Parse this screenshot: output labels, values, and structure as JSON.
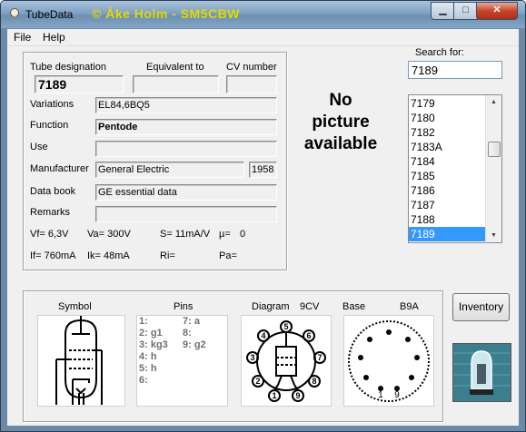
{
  "window": {
    "title": "TubeData",
    "credit": "© Åke Holm - SM5CBW"
  },
  "menu": {
    "file": "File",
    "help": "Help"
  },
  "labels": {
    "designation": "Tube designation",
    "equivalent": "Equivalent to",
    "cv": "CV number",
    "variations": "Variations",
    "function": "Function",
    "use": "Use",
    "manufacturer": "Manufacturer",
    "databook": "Data book",
    "remarks": "Remarks"
  },
  "values": {
    "designation": "7189",
    "equivalent": "",
    "cv": "",
    "variations": "EL84,6BQ5",
    "function": "Pentode",
    "use": "",
    "manufacturer": "General Electric",
    "year": "1958",
    "databook": "GE essential data",
    "remarks": ""
  },
  "specs": {
    "vf": "Vf= 6,3V",
    "va": "Va=  300V",
    "s": "S= 11mA/V",
    "mu": "µ=",
    "mu_val": "0",
    "if": "If= 760mA",
    "ik": "Ik=   48mA",
    "ri": "Ri=",
    "pa": "Pa="
  },
  "nopicture": {
    "line1": "No",
    "line2": "picture",
    "line3": "available"
  },
  "search": {
    "label": "Search for:",
    "value": "7189",
    "items": [
      "7179",
      "7180",
      "7182",
      "7183A",
      "7184",
      "7185",
      "7186",
      "7187",
      "7188",
      "7189"
    ],
    "selected": "7189"
  },
  "bottom": {
    "symbol": "Symbol",
    "pins": "Pins",
    "diagram": "Diagram",
    "diagram_code": "9CV",
    "base": "Base",
    "base_code": "B9A",
    "pins_left": [
      "1:",
      "2: g1",
      "3: kg3",
      "4: h",
      "5: h",
      "6:"
    ],
    "pins_right": [
      "7: a",
      "8:",
      "9: g2"
    ]
  },
  "buttons": {
    "inventory": "Inventory"
  }
}
